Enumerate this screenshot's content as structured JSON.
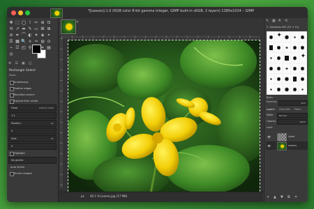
{
  "window": {
    "title": "*[Leaves]-1.0 (RGB color 8-bit gamma integer, GIMP built-in sRGB, 2 layers) 1280x1024 – GIMP"
  },
  "toolbox": {
    "tool_icons": [
      "✥",
      "⬚",
      "◯",
      "⌇",
      "✂",
      "⊕",
      "⊡",
      "⟲",
      "↗",
      "⬌",
      "✎",
      "▭",
      "⌘",
      "⊞",
      "⊘",
      "✒",
      "⌒",
      "◐",
      "✦",
      "◈",
      "⌖",
      "☰",
      "▦",
      "🔍",
      "⟡",
      "✑",
      "◍",
      "⊙",
      "⌁",
      "☷",
      "◰",
      "⚲",
      "⬢",
      "⌗",
      "▤",
      "◎"
    ],
    "options_tabs": [
      "⚙",
      "☰",
      "▣",
      "◱"
    ],
    "options_title": "Rectangle Select",
    "mode_label": "Mode:",
    "rows": [
      {
        "label": "Antialiasing",
        "box": true
      },
      {
        "label": "Feather edges",
        "box": true
      },
      {
        "label": "Rounded corners",
        "box": true
      },
      {
        "label": "Expand from center",
        "box": true
      },
      {
        "label": "Fixed",
        "right": "Aspect ratio",
        "field": true
      },
      {
        "label": "1:1",
        "field": true
      },
      {
        "label": "Position:",
        "right": "px",
        "field": true
      },
      {
        "label": "0",
        "field": true
      },
      {
        "label": "Size:",
        "right": "px",
        "field": true
      },
      {
        "label": "0",
        "field": true
      },
      {
        "label": "Highlight",
        "box": true
      },
      {
        "label": "No guides",
        "field": true
      },
      {
        "label": "Auto Shrink",
        "nobox": true
      },
      {
        "label": "Shrink merged",
        "box": true
      }
    ]
  },
  "canvas": {
    "status_unit": "px",
    "zoom": "46.1 %",
    "status_file": "Leaves.jpg (17 MB)"
  },
  "dock": {
    "brush_name": "2. Hardness 050 (51 × 51)",
    "brush_tag_label": "Basic.",
    "spacing_label": "Spacing",
    "spacing_value": "10.0",
    "layers_tabs": [
      "Layers",
      "Channels",
      "Paths"
    ],
    "mode_label": "Mode",
    "mode_value": "Normal",
    "opacity_label": "Opacity",
    "opacity_value": "100.0",
    "lock_label": "Lock:",
    "layers": [
      {
        "name": "Layer",
        "visible": true
      },
      {
        "name": "Leaves",
        "visible": true
      }
    ]
  }
}
